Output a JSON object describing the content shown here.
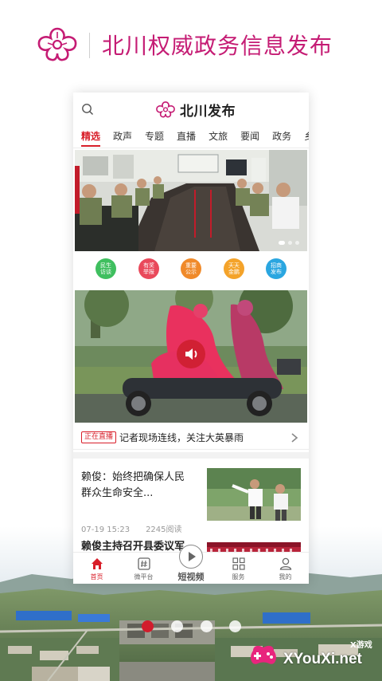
{
  "promo": {
    "title": "北川权威政务信息发布"
  },
  "app": {
    "brand_name": "北川发布",
    "tabs": [
      {
        "label": "精选",
        "active": true
      },
      {
        "label": "政声"
      },
      {
        "label": "专题"
      },
      {
        "label": "直播"
      },
      {
        "label": "文旅"
      },
      {
        "label": "要闻"
      },
      {
        "label": "政务"
      },
      {
        "label": "乡镇"
      }
    ],
    "hero": {
      "slides": 3,
      "active_slide": 1
    },
    "quick_links": [
      {
        "label": "民生访谈",
        "color": "#3fbf5f"
      },
      {
        "label": "有奖举报",
        "color": "#e9495b"
      },
      {
        "label": "重要公示",
        "color": "#f08a2a"
      },
      {
        "label": "天天金鹏",
        "color": "#f4a32a"
      },
      {
        "label": "招商发布",
        "color": "#2aa6e0"
      }
    ],
    "live": {
      "badge": "正在直播",
      "text": "记者现场连线，关注大英暴雨"
    },
    "news": [
      {
        "title": "赖俊：始终把确保人民群众生命安全...",
        "date": "07-19 15:23",
        "reads": "2245阅读"
      },
      {
        "title": "赖俊主持召开县委议军"
      }
    ],
    "nav": [
      {
        "label": "首页",
        "icon": "home-icon",
        "active": true
      },
      {
        "label": "微平台",
        "icon": "hashtag-icon"
      },
      {
        "label": "短视频",
        "icon": "play-icon"
      },
      {
        "label": "服务",
        "icon": "grid-icon"
      },
      {
        "label": "我的",
        "icon": "user-icon"
      }
    ]
  },
  "page_dots": {
    "count": 4,
    "active": 0
  },
  "watermark": {
    "top": "X游戏",
    "text": "XYouXi.net"
  },
  "colors": {
    "brand_magenta": "#c51c74",
    "accent_red": "#d81e29"
  }
}
